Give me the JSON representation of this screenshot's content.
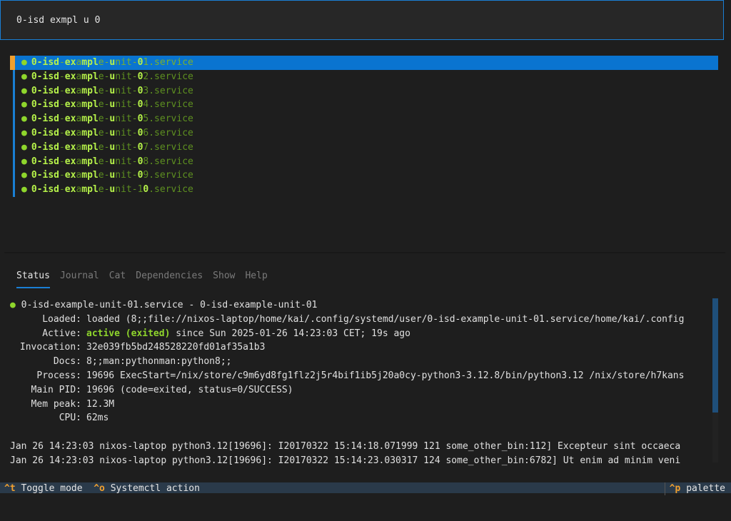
{
  "search": {
    "value": "0-isd exmpl u 0"
  },
  "units": [
    {
      "name": "0-isd-example-unit-01.service",
      "selected": true
    },
    {
      "name": "0-isd-example-unit-02.service",
      "selected": false
    },
    {
      "name": "0-isd-example-unit-03.service",
      "selected": false
    },
    {
      "name": "0-isd-example-unit-04.service",
      "selected": false
    },
    {
      "name": "0-isd-example-unit-05.service",
      "selected": false
    },
    {
      "name": "0-isd-example-unit-06.service",
      "selected": false
    },
    {
      "name": "0-isd-example-unit-07.service",
      "selected": false
    },
    {
      "name": "0-isd-example-unit-08.service",
      "selected": false
    },
    {
      "name": "0-isd-example-unit-09.service",
      "selected": false
    },
    {
      "name": "0-isd-example-unit-10.service",
      "selected": false
    }
  ],
  "tabs": [
    {
      "label": "Status",
      "active": true
    },
    {
      "label": "Journal",
      "active": false
    },
    {
      "label": "Cat",
      "active": false
    },
    {
      "label": "Dependencies",
      "active": false
    },
    {
      "label": "Show",
      "active": false
    },
    {
      "label": "Help",
      "active": false
    }
  ],
  "status": {
    "header": "0-isd-example-unit-01.service - 0-isd-example-unit-01",
    "fields": [
      {
        "key": "Loaded:",
        "value": "loaded (8;;file://nixos-laptop/home/kai/.config/systemd/user/0-isd-example-unit-01.service/home/kai/.config"
      },
      {
        "key": "Active:",
        "value_active": "active (exited)",
        "value": " since Sun 2025-01-26 14:23:03 CET; 19s ago"
      },
      {
        "key": "Invocation:",
        "value": "32e039fb5bd248528220fd01af35a1b3"
      },
      {
        "key": "Docs:",
        "value": "8;;man:pythonman:python8;;"
      },
      {
        "key": "Process:",
        "value": "19696 ExecStart=/nix/store/c9m6yd8fg1flz2j5r4bif1ib5j20a0cy-python3-3.12.8/bin/python3.12 /nix/store/h7kans"
      },
      {
        "key": "Main PID:",
        "value": "19696 (code=exited, status=0/SUCCESS)"
      },
      {
        "key": "Mem peak:",
        "value": "12.3M"
      },
      {
        "key": "CPU:",
        "value": "62ms"
      }
    ],
    "journal": [
      "Jan 26 14:23:03 nixos-laptop python3.12[19696]: I20170322 15:14:18.071999 121 some_other_bin:112] Excepteur sint occaeca",
      "Jan 26 14:23:03 nixos-laptop python3.12[19696]: I20170322 15:14:23.030317 124 some_other_bin:6782] Ut enim ad minim veni"
    ]
  },
  "footer": {
    "toggle_key": "^t",
    "toggle_label": "Toggle mode",
    "action_key": "^o",
    "action_label": "Systemctl action",
    "palette_key": "^p",
    "palette_label": "palette"
  }
}
